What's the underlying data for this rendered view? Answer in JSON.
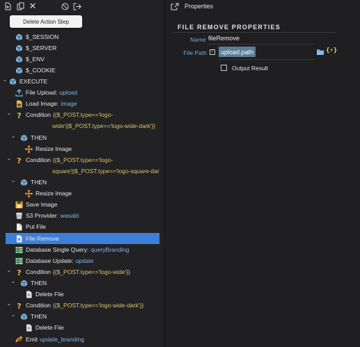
{
  "tooltip": "Delete Action Step",
  "left": {
    "rows": [
      {
        "label": "$_SESSION",
        "icon": "cube-icon"
      },
      {
        "label": "$_SERVER",
        "icon": "cube-icon"
      },
      {
        "label": "$_ENV",
        "icon": "cube-icon"
      },
      {
        "label": "$_COOKIE",
        "icon": "cube-icon"
      },
      {
        "label": "EXECUTE",
        "icon": "cube-icon"
      },
      {
        "label": "File Upload:",
        "value": "upload",
        "icon": "upload-icon"
      },
      {
        "label": "Load Image:",
        "value": "image",
        "icon": "image-file-icon"
      },
      {
        "label": "Condition",
        "cond": "{{$_POST.type=='logo-",
        "cond2": "wide'||$_POST.type=='logo-wide-dark'}}",
        "icon": "question-icon"
      },
      {
        "label": "THEN",
        "icon": "cube-icon"
      },
      {
        "label": "Resize Image",
        "icon": "resize-icon"
      },
      {
        "label": "Condition",
        "cond": "{{$_POST.type=='logo-",
        "cond2": "square'||$_POST.type=='logo-square-dar",
        "icon": "question-icon"
      },
      {
        "label": "THEN",
        "icon": "cube-icon"
      },
      {
        "label": "Resize Image",
        "icon": "resize-icon"
      },
      {
        "label": "Save Image",
        "icon": "save-icon"
      },
      {
        "label": "S3 Provider:",
        "value": "wasabi",
        "icon": "s3-icon"
      },
      {
        "label": "Put File",
        "icon": "file-icon"
      },
      {
        "label": "File Remove",
        "icon": "file-remove-icon"
      },
      {
        "label": "Database Single Query:",
        "value": "queryBranding",
        "icon": "table-icon"
      },
      {
        "label": "Database Update:",
        "value": "update",
        "icon": "table-icon"
      },
      {
        "label": "Condition",
        "cond": "{{$_POST.type=='logo-wide'}}",
        "icon": "question-icon"
      },
      {
        "label": "THEN",
        "icon": "cube-icon"
      },
      {
        "label": "Delete File",
        "icon": "delete-file-icon"
      },
      {
        "label": "Condition",
        "cond": "{{$_POST.type=='logo-wide-dark'}}",
        "icon": "question-icon"
      },
      {
        "label": "THEN",
        "icon": "cube-icon"
      },
      {
        "label": "Delete File",
        "icon": "delete-file-icon"
      },
      {
        "label": "Emit",
        "value": "update_branding",
        "icon": "emit-icon"
      }
    ]
  },
  "right": {
    "title": "Properties",
    "section": "FILE REMOVE PROPERTIES",
    "name_label": "Name",
    "name_value": "fileRemove",
    "filepath_label": "File Path",
    "filepath_value": "upload.path",
    "bind_symbol": "{⚡}",
    "checkbox_label": "Output Result"
  },
  "colors": {
    "selected": "#3d7fd8",
    "value": "#7db7e8",
    "condition": "#d8c36a",
    "label_blue": "#6fa7de"
  }
}
